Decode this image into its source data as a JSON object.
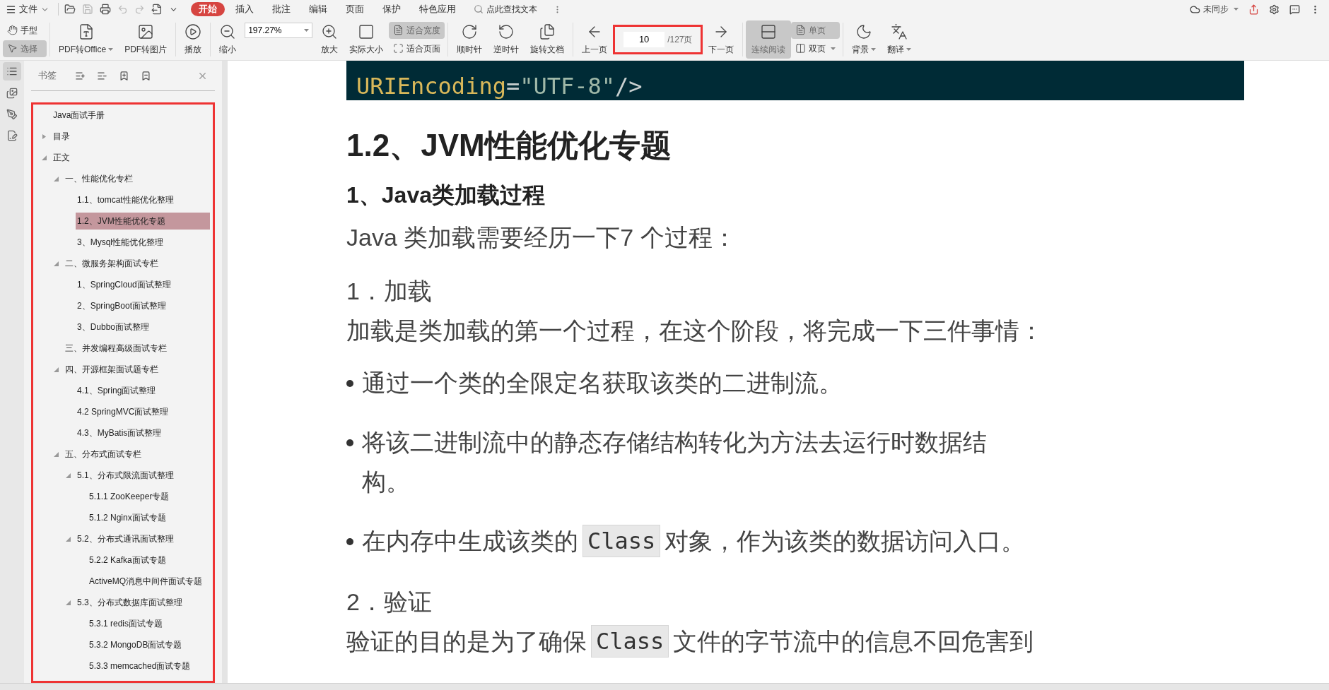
{
  "menu_bar": {
    "file_label": "文件",
    "tabs": [
      {
        "label": "开始",
        "selected": true
      },
      {
        "label": "插入",
        "selected": false
      },
      {
        "label": "批注",
        "selected": false
      },
      {
        "label": "编辑",
        "selected": false
      },
      {
        "label": "页面",
        "selected": false
      },
      {
        "label": "保护",
        "selected": false
      },
      {
        "label": "特色应用",
        "selected": false
      }
    ],
    "search_placeholder": "点此查找文本",
    "sync_label": "未同步"
  },
  "toolbar": {
    "hand": {
      "label": "手型",
      "selected": false
    },
    "select": {
      "label": "选择",
      "selected": true
    },
    "pdf_to_office": "PDF转Office",
    "pdf_to_image": "PDF转图片",
    "play": "播放",
    "zoom_out": "缩小",
    "zoom_value": "197.27%",
    "zoom_in": "放大",
    "actual_size": "实际大小",
    "fit_width": {
      "label": "适合宽度",
      "selected": true
    },
    "fit_page": {
      "label": "适合页面",
      "selected": false
    },
    "rotate_cw": "顺时针",
    "rotate_ccw": "逆时针",
    "rotate_doc": "旋转文档",
    "prev_page": "上一页",
    "page_value": "10",
    "page_total": "/127页",
    "page_outlined": true,
    "next_page": "下一页",
    "continuous": {
      "label": "连续阅读",
      "selected": true
    },
    "single": {
      "label": "单页",
      "selected": true
    },
    "double": {
      "label": "双页",
      "selected": false
    },
    "background": "背景",
    "translate": "翻译"
  },
  "sidebar": {
    "title": "书签",
    "outlined": true,
    "tree": [
      {
        "label": "Java面试手册"
      },
      {
        "label": "目录",
        "expanded": false
      },
      {
        "label": "正文",
        "expanded": true,
        "children": [
          {
            "label": "一、性能优化专栏",
            "expanded": true,
            "children": [
              {
                "label": "1.1、tomcat性能优化整理",
                "selected": false
              },
              {
                "label": "1.2、JVM性能优化专题",
                "selected": true
              },
              {
                "label": "3、Mysql性能优化整理",
                "selected": false
              }
            ]
          },
          {
            "label": "二、微服务架构面试专栏",
            "expanded": true,
            "children": [
              {
                "label": "1、SpringCloud面试整理",
                "selected": false
              },
              {
                "label": "2、SpringBoot面试整理",
                "selected": false
              },
              {
                "label": "3、Dubbo面试整理",
                "selected": false
              }
            ]
          },
          {
            "label": "三、并发编程高级面试专栏",
            "selected": false
          },
          {
            "label": "四、开源框架面试题专栏",
            "expanded": true,
            "children": [
              {
                "label": "4.1、Spring面试整理",
                "selected": false
              },
              {
                "label": "4.2 SpringMVC面试整理",
                "selected": false
              },
              {
                "label": "4.3、MyBatis面试整理",
                "selected": false
              }
            ]
          },
          {
            "label": "五、分布式面试专栏",
            "expanded": true,
            "children": [
              {
                "label": "5.1、分布式限流面试整理",
                "expanded": true,
                "children": [
                  {
                    "label": "5.1.1 ZooKeeper专题",
                    "selected": false
                  },
                  {
                    "label": "5.1.2 Nginx面试专题",
                    "selected": false
                  }
                ]
              },
              {
                "label": "5.2、分布式通讯面试整理",
                "expanded": true,
                "children": [
                  {
                    "label": "5.2.2 Kafka面试专题",
                    "selected": false
                  },
                  {
                    "label": "ActiveMQ消息中间件面试专题",
                    "selected": false
                  }
                ]
              },
              {
                "label": "5.3、分布式数据库面试整理",
                "expanded": true,
                "children": [
                  {
                    "label": "5.3.1 redis面试专题",
                    "selected": false
                  },
                  {
                    "label": "5.3.2 MongoDB面试专题",
                    "selected": false
                  },
                  {
                    "label": "5.3.3 memcached面试专题",
                    "selected": false
                  }
                ]
              }
            ]
          }
        ]
      }
    ]
  },
  "document": {
    "code": [
      {
        "text": "URIEncoding",
        "kind": "attr"
      },
      {
        "text": "=",
        "kind": "punct"
      },
      {
        "text": "\"UTF-8\"",
        "kind": "string"
      },
      {
        "text": "/>",
        "kind": "punct"
      }
    ],
    "blocks": [
      {
        "kind": "h1",
        "lines": [
          [
            {
              "text": "1.2、JVM性能优化专题"
            }
          ]
        ]
      },
      {
        "kind": "h2",
        "lines": [
          [
            {
              "text": "1、Java类加载过程"
            }
          ]
        ]
      },
      {
        "kind": "p",
        "lines": [
          [
            {
              "text": "Java 类加载需要经历一下7 个过程："
            }
          ]
        ]
      },
      {
        "kind": "h3",
        "lines": [
          [
            {
              "text": "1．加载"
            }
          ]
        ]
      },
      {
        "kind": "p",
        "lines": [
          [
            {
              "text": "加载是类加载的第一个过程，在这个阶段，将完成一下三件事情："
            }
          ]
        ]
      },
      {
        "kind": "bullet",
        "lines": [
          [
            {
              "text": "通过一个类的全限定名获取该类的二进制流。"
            }
          ]
        ]
      },
      {
        "kind": "bullet",
        "lines": [
          [
            {
              "text": "将该二进制流中的静态存储结构转化为方法去运行时数据结"
            }
          ],
          [
            {
              "text": "构。"
            }
          ]
        ]
      },
      {
        "kind": "bullet",
        "lines": [
          [
            {
              "text": "在内存中生成该类的"
            },
            {
              "text": "Class",
              "code": true
            },
            {
              "text": "对象，作为该类的数据访问入口。"
            }
          ]
        ]
      },
      {
        "kind": "h3",
        "lines": [
          [
            {
              "text": "2．验证"
            }
          ]
        ]
      },
      {
        "kind": "p",
        "lines": [
          [
            {
              "text": "验证的目的是为了确保"
            },
            {
              "text": "Class",
              "code": true
            },
            {
              "text": "文件的字节流中的信息不回危害到"
            }
          ]
        ]
      }
    ]
  }
}
